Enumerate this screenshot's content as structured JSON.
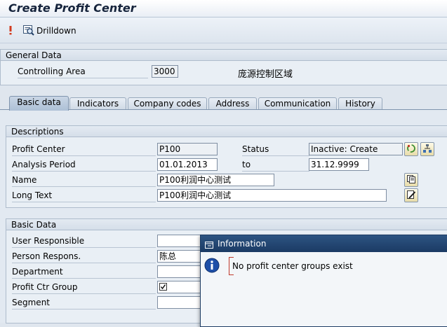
{
  "window": {
    "title": "Create Profit Center"
  },
  "toolbar": {
    "drilldown_label": "Drilldown"
  },
  "general_data": {
    "section_title": "General Data",
    "controlling_area_label": "Controlling Area",
    "controlling_area_value": "3000",
    "controlling_area_desc": "庞源控制区域"
  },
  "tabs": [
    {
      "label": "Basic data",
      "active": true
    },
    {
      "label": "Indicators"
    },
    {
      "label": "Company codes"
    },
    {
      "label": "Address"
    },
    {
      "label": "Communication"
    },
    {
      "label": "History"
    }
  ],
  "descriptions": {
    "section_title": "Descriptions",
    "profit_center_label": "Profit Center",
    "profit_center_value": "P100",
    "status_label": "Status",
    "status_value": "Inactive: Create",
    "analysis_period_label": "Analysis Period",
    "analysis_from": "01.01.2013",
    "to_label": "to",
    "analysis_to": "31.12.9999",
    "name_label": "Name",
    "name_value": "P100利润中心测试",
    "long_text_label": "Long Text",
    "long_text_value": "P100利润中心测试"
  },
  "basic_data": {
    "section_title": "Basic Data",
    "user_responsible_label": "User Responsible",
    "user_responsible_value": "",
    "person_responsible_label": "Person Respons.",
    "person_responsible_value": "陈总",
    "department_label": "Department",
    "department_value": "",
    "profit_ctr_group_label": "Profit Ctr Group",
    "segment_label": "Segment",
    "segment_value": ""
  },
  "dialog": {
    "title": "Information",
    "message": "No profit center groups exist"
  }
}
